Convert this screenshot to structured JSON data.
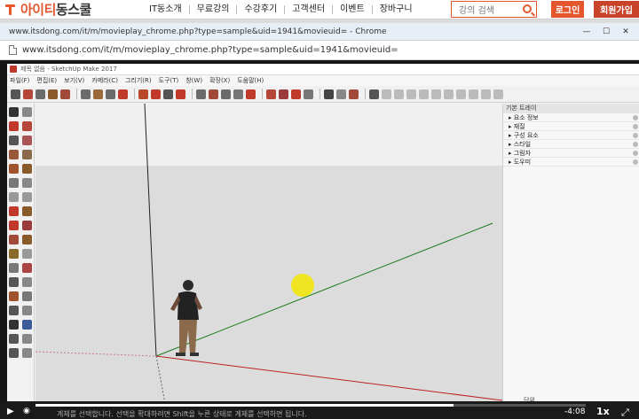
{
  "header": {
    "logo_part1": "아이티",
    "logo_part2": "동",
    "logo_part3": "스쿨",
    "nav": [
      "IT동소개",
      "무료강의",
      "수강후기",
      "고객센터",
      "이벤트",
      "장바구니"
    ],
    "search_placeholder": "강의 검색",
    "login_label": "로그인",
    "join_label": "회원가입",
    "accent_color": "#e4572e"
  },
  "chrome": {
    "window_title": "www.itsdong.com/it/m/movieplay_chrome.php?type=sample&uid=1941&movieuid= - Chrome",
    "address": "www.itsdong.com/it/m/movieplay_chrome.php?type=sample&uid=1941&movieuid="
  },
  "sketchup": {
    "window_title": "제목 없음 - SketchUp Make 2017",
    "menu": [
      "파일(F)",
      "편집(E)",
      "보기(V)",
      "카메라(C)",
      "그리기(R)",
      "도구(T)",
      "창(W)",
      "확장(X)",
      "도움말(H)"
    ],
    "tray_title": "기본 트레이",
    "tray_items": [
      "▸ 요소 정보",
      "▸ 재질",
      "▸ 구성 요소",
      "▸ 스타일",
      "▸ 그림자",
      "▸ 도우미"
    ],
    "hint_label": "단위"
  },
  "player": {
    "time": "-4:08",
    "speed": "1x",
    "progress": 0.76,
    "subtitle": "계체를 선택합니다. 선택을 확대하려면 Shift을 누른 상태로 계체를 선택하면 됩니다."
  }
}
